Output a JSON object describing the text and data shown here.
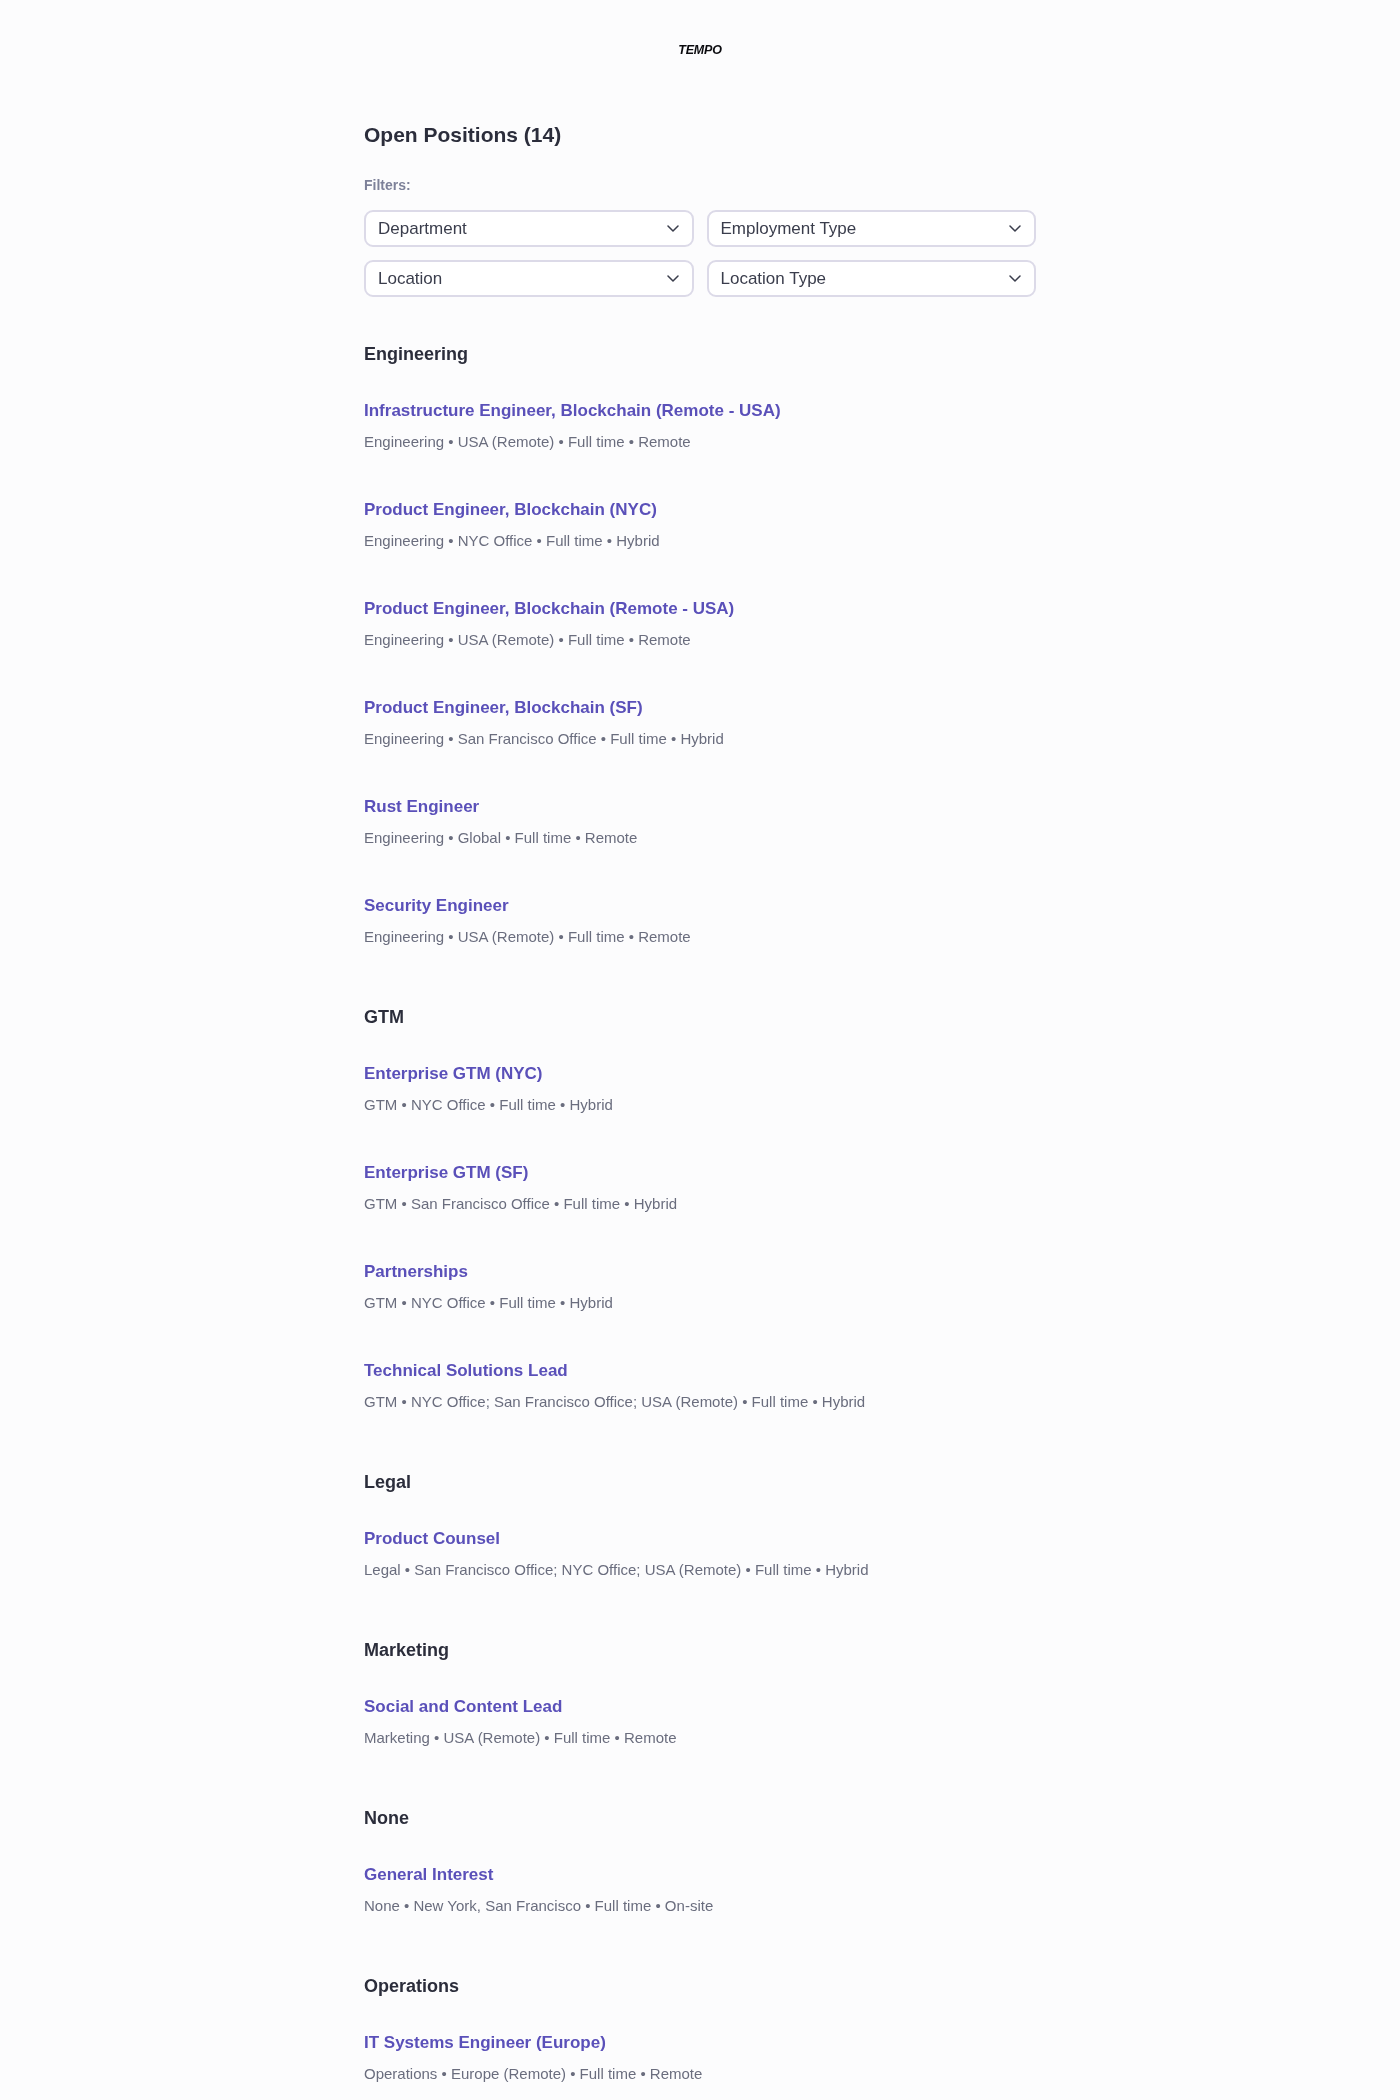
{
  "logo": "TEMPO",
  "title": "Open Positions (14)",
  "filters": {
    "label": "Filters:",
    "dropdowns": [
      {
        "label": "Department"
      },
      {
        "label": "Employment Type"
      },
      {
        "label": "Location"
      },
      {
        "label": "Location Type"
      }
    ]
  },
  "sections": [
    {
      "heading": "Engineering",
      "jobs": [
        {
          "title": "Infrastructure Engineer, Blockchain (Remote - USA)",
          "details": "Engineering • USA (Remote) • Full time • Remote"
        },
        {
          "title": "Product Engineer, Blockchain (NYC)",
          "details": "Engineering • NYC Office • Full time • Hybrid"
        },
        {
          "title": "Product Engineer, Blockchain (Remote - USA)",
          "details": "Engineering • USA (Remote) • Full time • Remote"
        },
        {
          "title": "Product Engineer, Blockchain (SF)",
          "details": "Engineering • San Francisco Office • Full time • Hybrid"
        },
        {
          "title": "Rust Engineer",
          "details": "Engineering • Global • Full time • Remote"
        },
        {
          "title": "Security Engineer",
          "details": "Engineering • USA (Remote) • Full time • Remote"
        }
      ]
    },
    {
      "heading": "GTM",
      "jobs": [
        {
          "title": "Enterprise GTM (NYC)",
          "details": "GTM • NYC Office • Full time • Hybrid"
        },
        {
          "title": "Enterprise GTM (SF)",
          "details": "GTM • San Francisco Office • Full time • Hybrid"
        },
        {
          "title": "Partnerships",
          "details": "GTM • NYC Office • Full time • Hybrid"
        },
        {
          "title": "Technical Solutions Lead",
          "details": "GTM • NYC Office; San Francisco Office; USA (Remote) • Full time • Hybrid"
        }
      ]
    },
    {
      "heading": "Legal",
      "jobs": [
        {
          "title": "Product Counsel",
          "details": "Legal • San Francisco Office; NYC Office; USA (Remote) • Full time • Hybrid"
        }
      ]
    },
    {
      "heading": "Marketing",
      "jobs": [
        {
          "title": "Social and Content Lead",
          "details": "Marketing • USA (Remote) • Full time • Remote"
        }
      ]
    },
    {
      "heading": "None",
      "jobs": [
        {
          "title": "General Interest",
          "details": "None • New York, San Francisco • Full time • On-site"
        }
      ]
    },
    {
      "heading": "Operations",
      "jobs": [
        {
          "title": "IT Systems Engineer (Europe)",
          "details": "Operations • Europe (Remote) • Full time • Remote"
        }
      ]
    }
  ]
}
